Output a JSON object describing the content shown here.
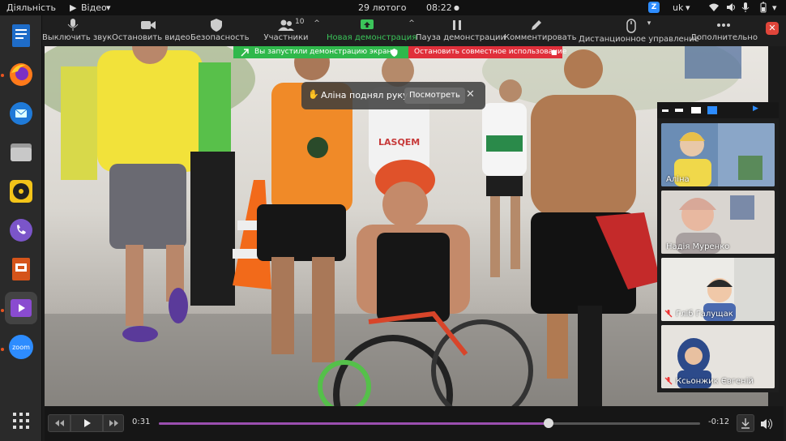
{
  "topbar": {
    "activities": "Діяльність",
    "video_menu": "Відео",
    "date": "29 лютого",
    "time": "08:22",
    "lang": "uk"
  },
  "dock": {
    "items": [
      "libreoffice-writer-icon",
      "firefox-icon",
      "thunderbird-icon",
      "files-icon",
      "rhythmbox-icon",
      "viber-icon",
      "libreoffice-impress-icon",
      "video-player-icon",
      "zoom-app-icon",
      "show-apps-icon"
    ]
  },
  "toolbar": {
    "mute": "Выключить звук",
    "stop_video": "Остановить видео",
    "security": "Безопасность",
    "participants": "Участники",
    "participants_count": "10",
    "new_share": "Новая демонстрация",
    "pause_share": "Пауза демонстрации",
    "annotate": "Комментировать",
    "remote_control": "Дистанционное управление",
    "more": "Дополнительно"
  },
  "share_banner": {
    "status": "Вы запустили демонстрацию экрана",
    "stop": "Остановить совместное использование"
  },
  "toast": {
    "message": "Аліна поднял руку",
    "view": "Посмотреть"
  },
  "gallery": {
    "tiles": [
      {
        "name": "Аліна",
        "muted": false
      },
      {
        "name": "Надія Муренко",
        "muted": false
      },
      {
        "name": "Гліб Галущак",
        "muted": true
      },
      {
        "name": "Ксьонжик Євгеній",
        "muted": true
      }
    ]
  },
  "player": {
    "elapsed": "0:31",
    "remaining": "-0:12",
    "progress": 0.72
  },
  "colors": {
    "accent_green": "#2fb84b",
    "stop_red": "#e02f3a",
    "progress_purple": "#9b4fb0"
  }
}
